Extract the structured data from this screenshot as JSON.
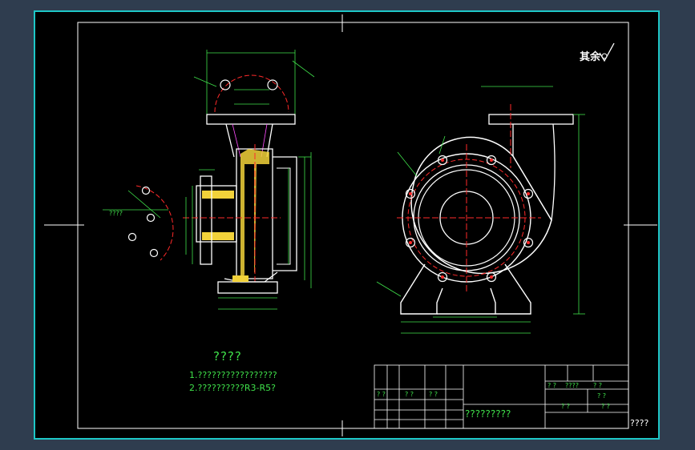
{
  "notes": {
    "title": "????",
    "line1": "1.?????????????????",
    "line2": "2.??????????R3-R5?"
  },
  "roughness_note": "其余",
  "title_block": {
    "big_text": "?????????",
    "corner": "????",
    "cells": [
      "?  ?",
      "? ?",
      "? ?",
      "?  ?",
      "????",
      "? ?",
      "? ?",
      "?  ?",
      "? ?"
    ]
  },
  "left_view_label": "????",
  "colors": {
    "background": "#000000",
    "frame": "#ffffff",
    "outer_bg": "#2f3d4f",
    "border_cyan": "#1ec7c7",
    "green": "#3fe04a",
    "red": "#ff2a2a",
    "yellow": "#f2d23a",
    "magenta": "#ff4dff"
  }
}
